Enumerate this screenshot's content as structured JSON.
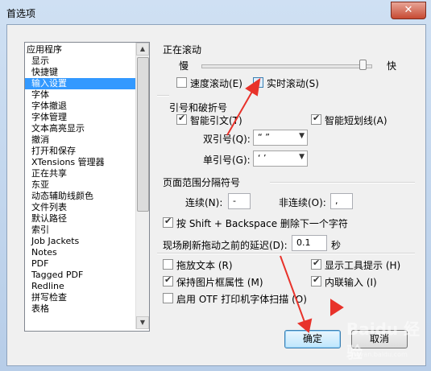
{
  "window": {
    "title": "首选项",
    "close_symbol": "✕"
  },
  "sidebar": {
    "items": [
      {
        "label": "应用程序"
      },
      {
        "label": "显示"
      },
      {
        "label": "快捷键"
      },
      {
        "label": "输入设置"
      },
      {
        "label": "字体"
      },
      {
        "label": "字体撤退"
      },
      {
        "label": "字体管理"
      },
      {
        "label": "文本高亮显示"
      },
      {
        "label": "撤消"
      },
      {
        "label": "打开和保存"
      },
      {
        "label": "XTensions 管理器"
      },
      {
        "label": "正在共享"
      },
      {
        "label": "东亚"
      },
      {
        "label": "动态辅助线颜色"
      },
      {
        "label": "文件列表"
      },
      {
        "label": "默认路径"
      },
      {
        "label": "索引"
      },
      {
        "label": "Job Jackets"
      },
      {
        "label": "Notes"
      },
      {
        "label": "PDF"
      },
      {
        "label": "Tagged PDF"
      },
      {
        "label": "Redline"
      },
      {
        "label": "拼写检查"
      },
      {
        "label": "表格"
      }
    ],
    "selected_index": 3
  },
  "scrolling": {
    "title": "正在滚动",
    "slow_label": "慢",
    "fast_label": "快",
    "slider_value_fraction": 0.95,
    "speed_scroll_label": "速度滚动(E)",
    "speed_scroll_checked": false,
    "live_scroll_label": "实时滚动(S)",
    "live_scroll_checked": false
  },
  "quotes": {
    "title": "引号和破折号",
    "smart_quotes_label": "智能引文(T)",
    "smart_quotes_checked": true,
    "smart_dash_label": "智能短划线(A)",
    "smart_dash_checked": true,
    "double_label": "双引号(Q):",
    "double_value": "“  ”",
    "single_label": "单引号(G):",
    "single_value": "‘  ’"
  },
  "page_range": {
    "title": "页面范围分隔符号",
    "continuous_label": "连续(N):",
    "continuous_value": "-",
    "noncontinuous_label": "非连续(O):",
    "noncontinuous_value": ","
  },
  "options": {
    "shift_backspace_label": "按 Shift + Backspace 删除下一个字符",
    "shift_backspace_checked": true,
    "delay_label": "现场刷新拖动之前的延迟(D):",
    "delay_value": "0.1",
    "delay_unit": "秒",
    "drag_text_label": "拖放文本 (R)",
    "drag_text_checked": false,
    "show_tooltips_label": "显示工具提示 (H)",
    "show_tooltips_checked": true,
    "keep_picture_label": "保持图片框属性 (M)",
    "keep_picture_checked": true,
    "inline_input_label": "内联输入 (I)",
    "inline_input_checked": true,
    "otf_label": "启用 OTF 打印机字体扫描 (O)",
    "otf_checked": false
  },
  "buttons": {
    "ok": "确定",
    "cancel": "取消"
  },
  "scrollbar": {
    "up_icon": "▲",
    "down_icon": "▼"
  },
  "combo_arrow": "▼",
  "colors": {
    "accent": "#3399ff",
    "annotation": "#e8322a"
  },
  "watermark": {
    "text": "Baidu 经验",
    "subtext": "jingyan.baidu.com"
  }
}
